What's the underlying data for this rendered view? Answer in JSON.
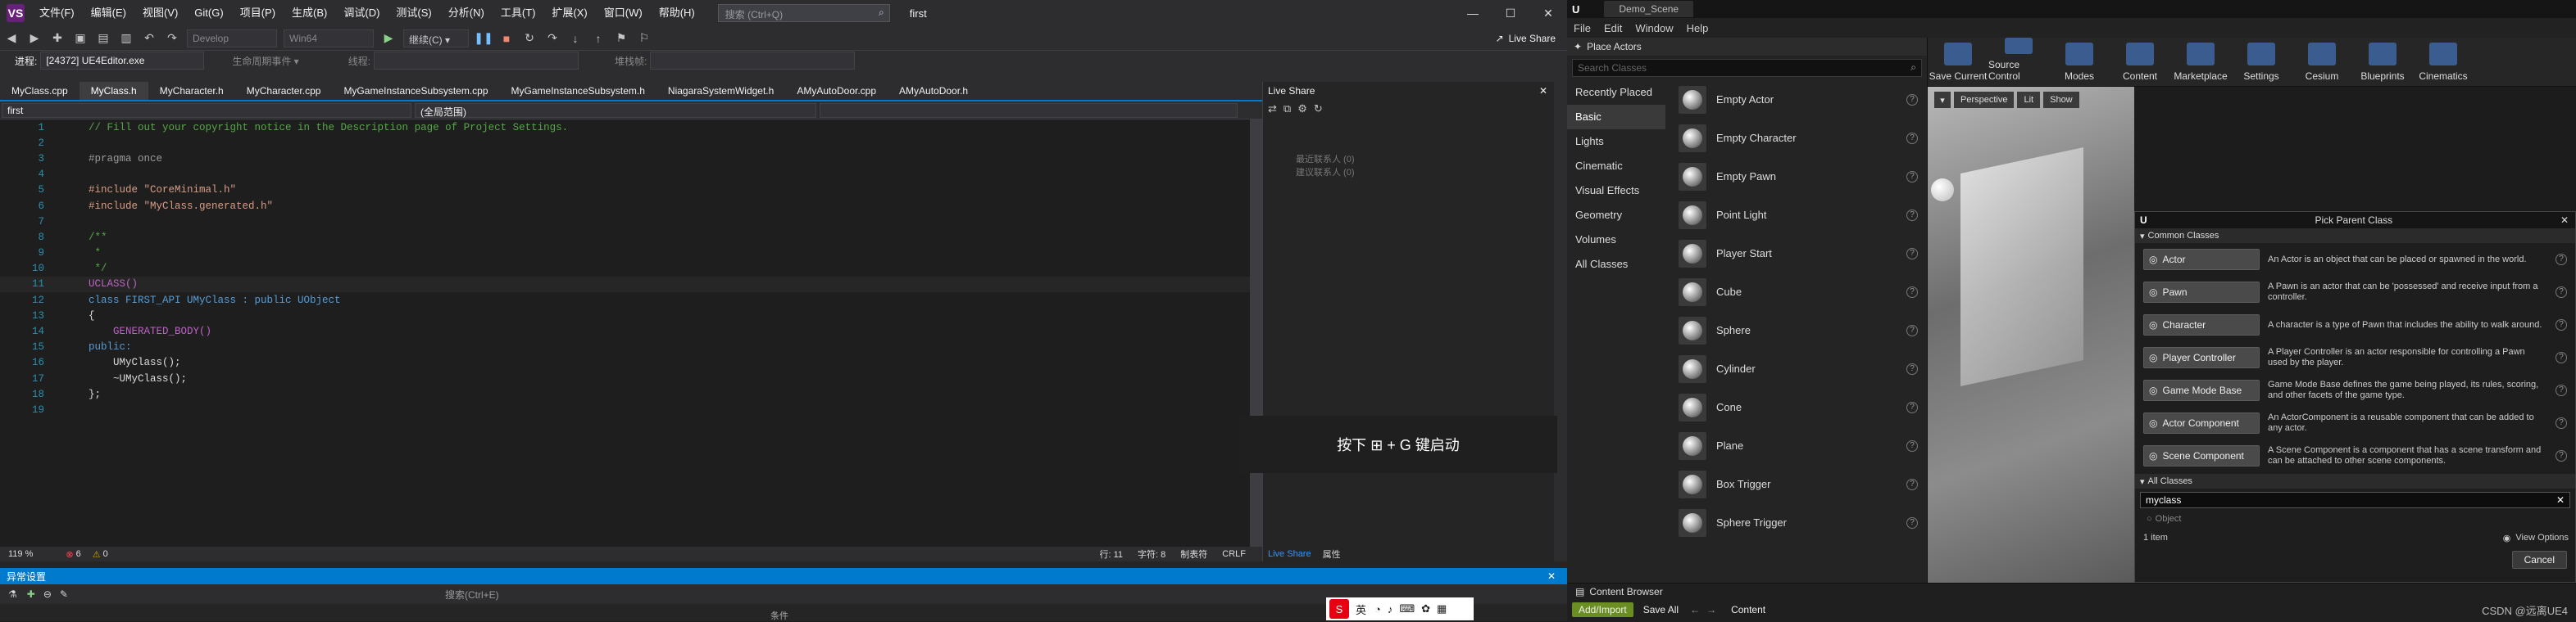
{
  "vs": {
    "logo": "VS",
    "menu": [
      "文件(F)",
      "编辑(E)",
      "视图(V)",
      "Git(G)",
      "项目(P)",
      "生成(B)",
      "调试(D)",
      "测试(S)",
      "分析(N)",
      "工具(T)",
      "扩展(X)",
      "窗口(W)",
      "帮助(H)"
    ],
    "search_placeholder": "搜索 (Ctrl+Q)",
    "solution_title": "first",
    "live_share": "Live Share",
    "config_combo": "Develop",
    "platform_combo": "Win64",
    "attach_label": "继续(C) ▾",
    "process_label": "进程:",
    "process_value": "[24372] UE4Editor.exe",
    "lifecycle_label": "生命周期事件 ▾",
    "thread_label": "线程:",
    "stack_label": "堆栈帧:",
    "tabs": [
      "MyClass.cpp",
      "MyClass.h",
      "MyCharacter.h",
      "MyCharacter.cpp",
      "MyGameInstanceSubsystem.cpp",
      "MyGameInstanceSubsystem.h",
      "NiagaraSystemWidget.h",
      "AMyAutoDoor.cpp",
      "AMyAutoDoor.h"
    ],
    "nav_project": "first",
    "nav_scope": "(全局范围)",
    "code_lines": [
      {
        "n": "1",
        "t": "// Fill out your copyright notice in the Description page of Project Settings.",
        "c": "cm"
      },
      {
        "n": "2",
        "t": "",
        "c": "fg"
      },
      {
        "n": "3",
        "t": "#pragma once",
        "c": "pp"
      },
      {
        "n": "4",
        "t": "",
        "c": "fg"
      },
      {
        "n": "5",
        "t": "#include \"CoreMinimal.h\"",
        "c": "str"
      },
      {
        "n": "6",
        "t": "#include \"MyClass.generated.h\"",
        "c": "str"
      },
      {
        "n": "7",
        "t": "",
        "c": "fg"
      },
      {
        "n": "8",
        "t": "/**",
        "c": "cm"
      },
      {
        "n": "9",
        "t": " *",
        "c": "cm"
      },
      {
        "n": "10",
        "t": " */",
        "c": "cm"
      },
      {
        "n": "11",
        "t": "UCLASS()",
        "c": "mac"
      },
      {
        "n": "12",
        "t": "class FIRST_API UMyClass : public UObject",
        "c": "kw"
      },
      {
        "n": "13",
        "t": "{",
        "c": "fg"
      },
      {
        "n": "14",
        "t": "    GENERATED_BODY()",
        "c": "mac"
      },
      {
        "n": "15",
        "t": "public:",
        "c": "kw"
      },
      {
        "n": "16",
        "t": "    UMyClass();",
        "c": "fg"
      },
      {
        "n": "17",
        "t": "    ~UMyClass();",
        "c": "fg"
      },
      {
        "n": "18",
        "t": "};",
        "c": "fg"
      },
      {
        "n": "19",
        "t": "",
        "c": "fg"
      }
    ],
    "zoom": "119 %",
    "errors": "6",
    "warnings": "0",
    "line_info": "行: 11",
    "char_info": "字符: 8",
    "tab_info": "制表符",
    "eol_info": "CRLF",
    "live_share_panel_title": "Live Share",
    "live_share_items": [
      "最近联系人 (0)",
      "建议联系人 (0)"
    ],
    "live_share_tab": "Live Share",
    "props_tab": "属性",
    "bottom_panel_title": "异常设置",
    "bottom_search": "搜索(Ctrl+E)",
    "bottom_col": "条件",
    "win_hint": "按下 ⊞ + G 键启动",
    "ime_label": "英"
  },
  "ue": {
    "tab_title": "Demo_Scene",
    "menu": [
      "File",
      "Edit",
      "Window",
      "Help"
    ],
    "place_actors_title": "Place Actors",
    "search_classes_placeholder": "Search Classes",
    "categories": [
      "Recently Placed",
      "Basic",
      "Lights",
      "Cinematic",
      "Visual Effects",
      "Geometry",
      "Volumes",
      "All Classes"
    ],
    "actors": [
      "Empty Actor",
      "Empty Character",
      "Empty Pawn",
      "Point Light",
      "Player Start",
      "Cube",
      "Sphere",
      "Cylinder",
      "Cone",
      "Plane",
      "Box Trigger",
      "Sphere Trigger"
    ],
    "toolbar": [
      "Save Current",
      "Source Control",
      "Modes",
      "Content",
      "Marketplace",
      "Settings",
      "Cesium",
      "Blueprints",
      "Cinematics"
    ],
    "viewport_buttons": [
      "Perspective",
      "Lit",
      "Show"
    ],
    "modal": {
      "title": "Pick Parent Class",
      "common_heading": "Common Classes",
      "classes": [
        {
          "name": "Actor",
          "desc": "An Actor is an object that can be placed or spawned in the world."
        },
        {
          "name": "Pawn",
          "desc": "A Pawn is an actor that can be 'possessed' and receive input from a controller."
        },
        {
          "name": "Character",
          "desc": "A character is a type of Pawn that includes the ability to walk around."
        },
        {
          "name": "Player Controller",
          "desc": "A Player Controller is an actor responsible for controlling a Pawn used by the player."
        },
        {
          "name": "Game Mode Base",
          "desc": "Game Mode Base defines the game being played, its rules, scoring, and other facets of the game type."
        },
        {
          "name": "Actor Component",
          "desc": "An ActorComponent is a reusable component that can be added to any actor."
        },
        {
          "name": "Scene Component",
          "desc": "A Scene Component is a component that has a scene transform and can be attached to other scene components."
        }
      ],
      "all_heading": "All Classes",
      "search_value": "myclass",
      "result": "Object",
      "item_count": "1 item",
      "view_options": "View Options",
      "cancel": "Cancel"
    },
    "content_browser_tab": "Content Browser",
    "add_import": "Add/Import",
    "save_all": "Save All",
    "content_crumb": "Content",
    "watermark": "CSDN @远离UE4"
  }
}
